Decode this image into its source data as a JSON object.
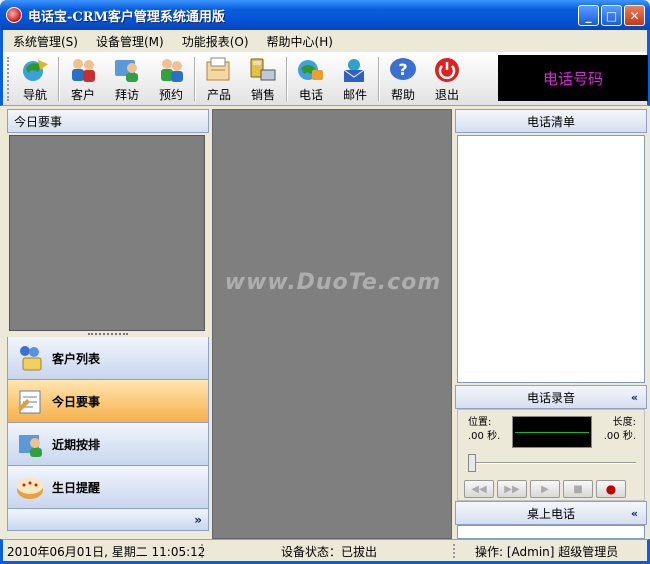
{
  "window": {
    "title": "电话宝-CRM客户管理系统通用版",
    "min_label": "_",
    "max_label": "□",
    "close_label": "✕"
  },
  "menu": [
    {
      "label": "系统管理(S)"
    },
    {
      "label": "设备管理(M)"
    },
    {
      "label": "功能报表(O)"
    },
    {
      "label": "帮助中心(H)"
    }
  ],
  "toolbar": {
    "items": [
      {
        "label": "导航",
        "icon": "navigation-icon"
      },
      {
        "label": "客户",
        "icon": "customer-icon"
      },
      {
        "label": "拜访",
        "icon": "visit-icon"
      },
      {
        "label": "预约",
        "icon": "appointment-icon"
      },
      {
        "label": "产品",
        "icon": "product-icon"
      },
      {
        "label": "销售",
        "icon": "sales-icon"
      },
      {
        "label": "电话",
        "icon": "phone-icon"
      },
      {
        "label": "邮件",
        "icon": "mail-icon"
      },
      {
        "label": "帮助",
        "icon": "help-icon"
      },
      {
        "label": "退出",
        "icon": "exit-icon"
      }
    ],
    "phone_display": "电话号码"
  },
  "left_panel": {
    "header": "今日要事",
    "nav": [
      {
        "label": "客户列表",
        "icon": "customer-list-icon",
        "active": false
      },
      {
        "label": "今日要事",
        "icon": "today-tasks-icon",
        "active": true
      },
      {
        "label": "近期按排",
        "icon": "schedule-icon",
        "active": false
      },
      {
        "label": "生日提醒",
        "icon": "birthday-cake-icon",
        "active": false
      }
    ],
    "more": "»"
  },
  "center": {
    "watermark": "www.DuoTe.com"
  },
  "right_panel": {
    "call_list_header": "电话清单",
    "recording_header": "电话录音",
    "recording_chevron": "«",
    "position_label": "位置:",
    "position_value": ".00 秒.",
    "length_label": "长度:",
    "length_value": ".00 秒.",
    "controls": [
      "◀◀",
      "▶▶",
      "▶",
      "■",
      "●"
    ],
    "desk_phone_header": "桌上电话",
    "desk_chevron": "«"
  },
  "statusbar": {
    "datetime": "2010年06月01日, 星期二   11:05:12",
    "device_status": "设备状态：已拔出",
    "operator": "操作: [Admin] 超级管理员"
  },
  "colors": {
    "title_blue": "#0453d6",
    "phone_display_text": "#e020e0",
    "active_nav": "#f7b04a",
    "workspace_gray": "#7f7f7f"
  }
}
